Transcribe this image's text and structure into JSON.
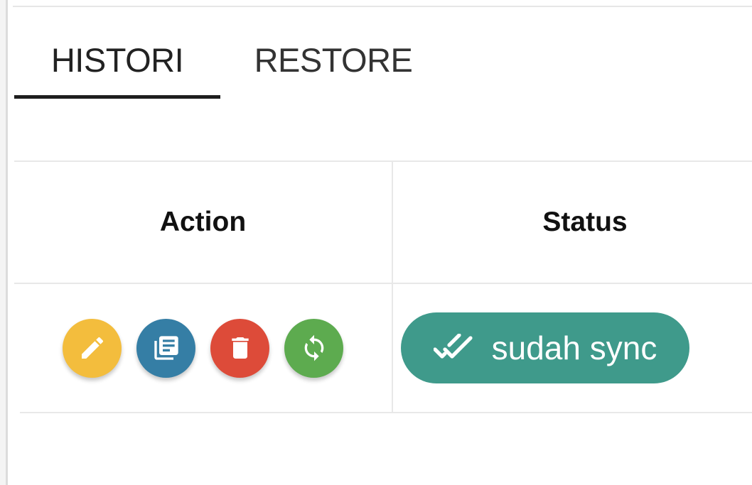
{
  "tabs": [
    {
      "label": "HISTORI",
      "active": true
    },
    {
      "label": "RESTORE",
      "active": false
    }
  ],
  "table": {
    "columns": [
      "Action",
      "Status"
    ],
    "rows": [
      {
        "actions": [
          {
            "icon": "pencil-icon",
            "color": "#f3bd3d"
          },
          {
            "icon": "copy-document-icon",
            "color": "#357ea5"
          },
          {
            "icon": "trash-icon",
            "color": "#dd4b39"
          },
          {
            "icon": "sync-icon",
            "color": "#5dab4f"
          }
        ],
        "status": {
          "icon": "double-check-icon",
          "label": "sudah sync",
          "color": "#3f9a8b"
        }
      }
    ]
  },
  "colors": {
    "tab_underline": "#1e1e1e",
    "grid": "#e8e8e8"
  }
}
